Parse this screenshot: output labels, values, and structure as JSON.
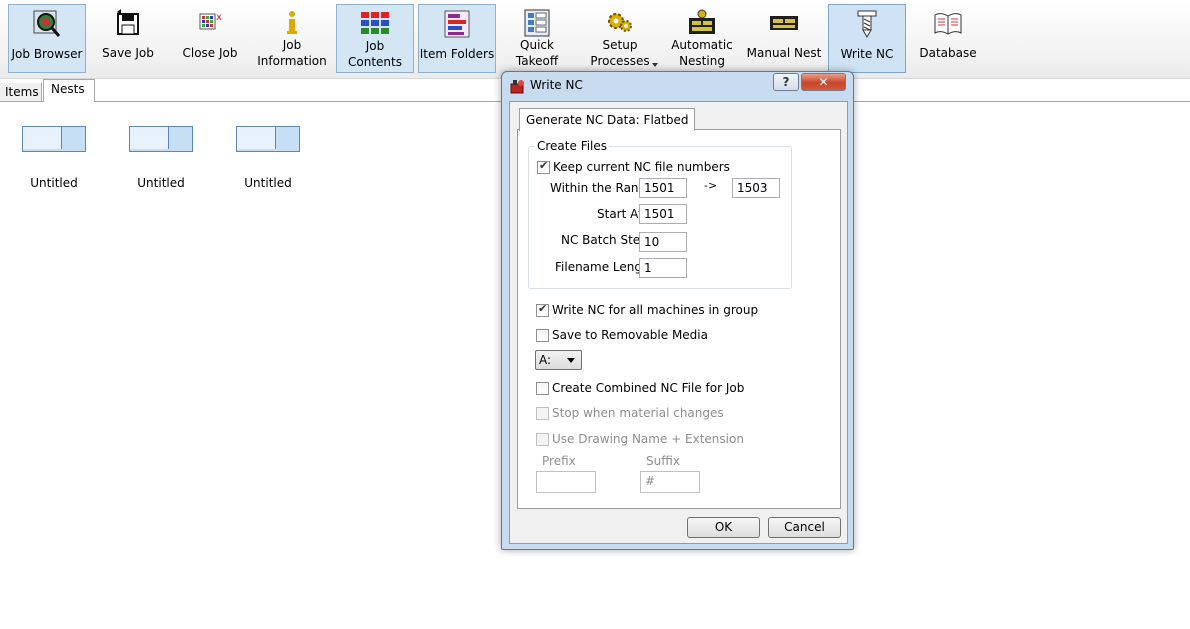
{
  "toolbar": {
    "job_browser": "Job Browser",
    "save_job": "Save Job",
    "close_job": "Close Job",
    "job_information_1": "Job",
    "job_information_2": "Information",
    "job_contents_1": "Job",
    "job_contents_2": "Contents",
    "item_folders": "Item Folders",
    "quick_takeoff_1": "Quick",
    "quick_takeoff_2": "Takeoff",
    "setup_processes_1": "Setup",
    "setup_processes_2": "Processes",
    "automatic_nesting_1": "Automatic",
    "automatic_nesting_2": "Nesting",
    "manual_nest": "Manual Nest",
    "write_nc": "Write NC",
    "database": "Database"
  },
  "tabs": {
    "items": "Items",
    "nests": "Nests"
  },
  "nests": [
    {
      "name": "Untitled"
    },
    {
      "name": "Untitled"
    },
    {
      "name": "Untitled"
    }
  ],
  "dialog": {
    "title": "Write NC",
    "help_glyph": "?",
    "close_glyph": "✕",
    "tab_label": "Generate NC Data: Flatbed",
    "create_files": {
      "title": "Create Files",
      "keep_numbers_label": "Keep current NC file numbers",
      "keep_numbers_checked": true,
      "within_range_label": "Within the Range",
      "range_from": "1501",
      "range_arrow": "->",
      "range_to": "1503",
      "start_at_label": "Start At",
      "start_at": "1501",
      "batch_step_label": "NC Batch Step",
      "batch_step": "10",
      "filename_length_label": "Filename Length",
      "filename_length": "1"
    },
    "write_all_label": "Write NC for all machines in group",
    "write_all_checked": true,
    "removable_label": "Save to Removable Media",
    "removable_checked": false,
    "drive_value": "A:",
    "combined_label": "Create Combined NC File for Job",
    "combined_checked": false,
    "stop_material_label": "Stop when material changes",
    "use_drawing_label": "Use Drawing Name + Extension",
    "prefix_label": "Prefix",
    "prefix_value": "",
    "suffix_label": "Suffix",
    "suffix_value": "#",
    "ok": "OK",
    "cancel": "Cancel"
  },
  "colors": {
    "selected_button": "#cfe3f5",
    "nest_fill": "#c7dff5",
    "dialog_frame": "#c9dcef"
  }
}
